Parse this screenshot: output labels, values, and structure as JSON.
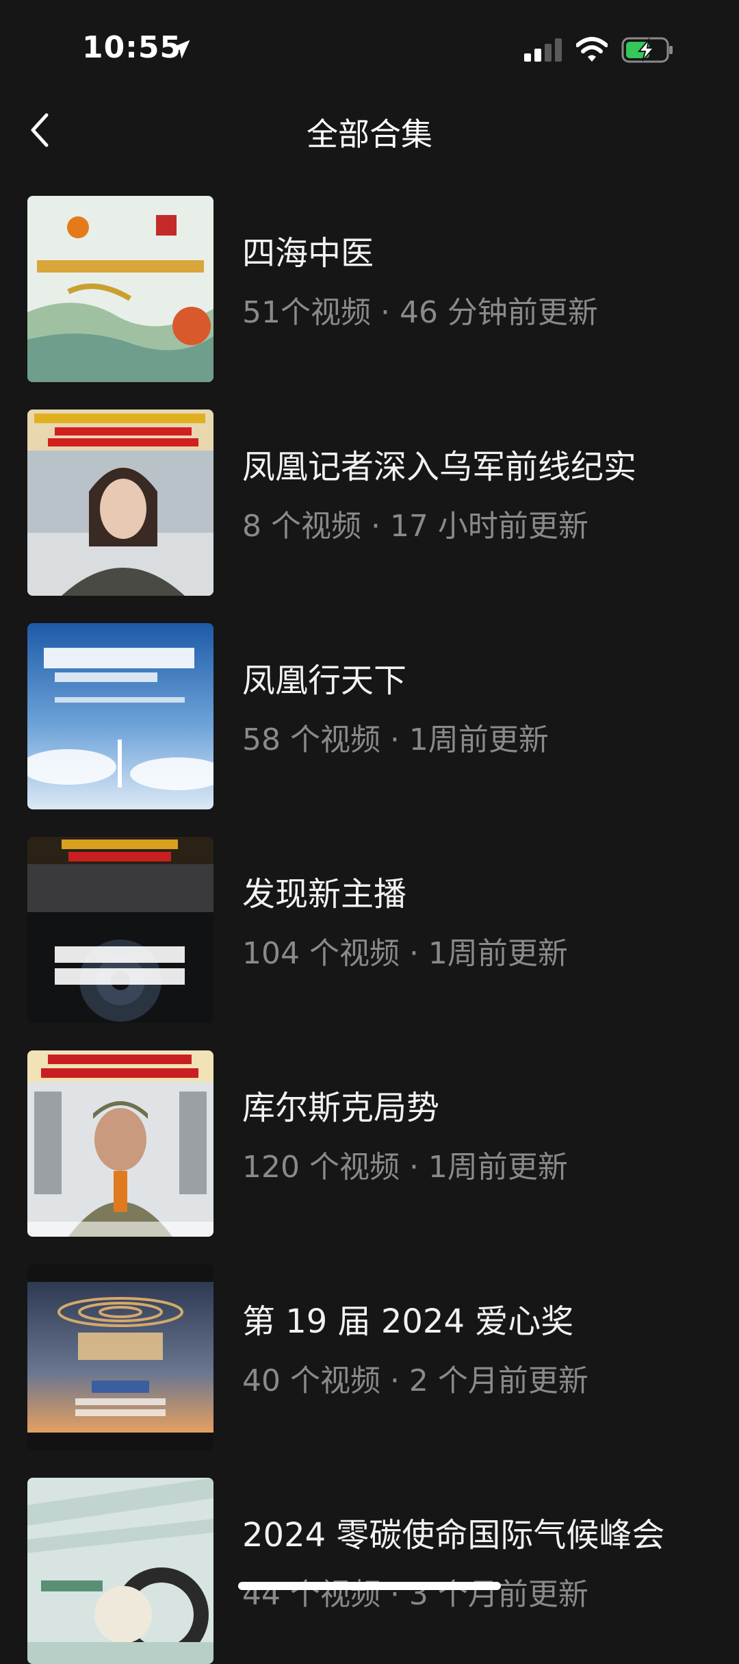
{
  "status": {
    "time": "10:55"
  },
  "nav": {
    "title": "全部合集"
  },
  "collections": [
    {
      "title": "四海中医",
      "meta": "51个视频 · 46 分钟前更新"
    },
    {
      "title": "凤凰记者深入乌军前线纪实",
      "meta": "8 个视频 · 17 小时前更新"
    },
    {
      "title": "凤凰行天下",
      "meta": "58 个视频 · 1周前更新"
    },
    {
      "title": "发现新主播",
      "meta": "104 个视频 · 1周前更新"
    },
    {
      "title": "库尔斯克局势",
      "meta": "120 个视频 · 1周前更新"
    },
    {
      "title": "第 19 届 2024 爱心奖",
      "meta": "40 个视频 · 2 个月前更新"
    },
    {
      "title": "2024 零碳使命国际气候峰会",
      "meta": "44 个视频 · 3 个月前更新"
    }
  ]
}
